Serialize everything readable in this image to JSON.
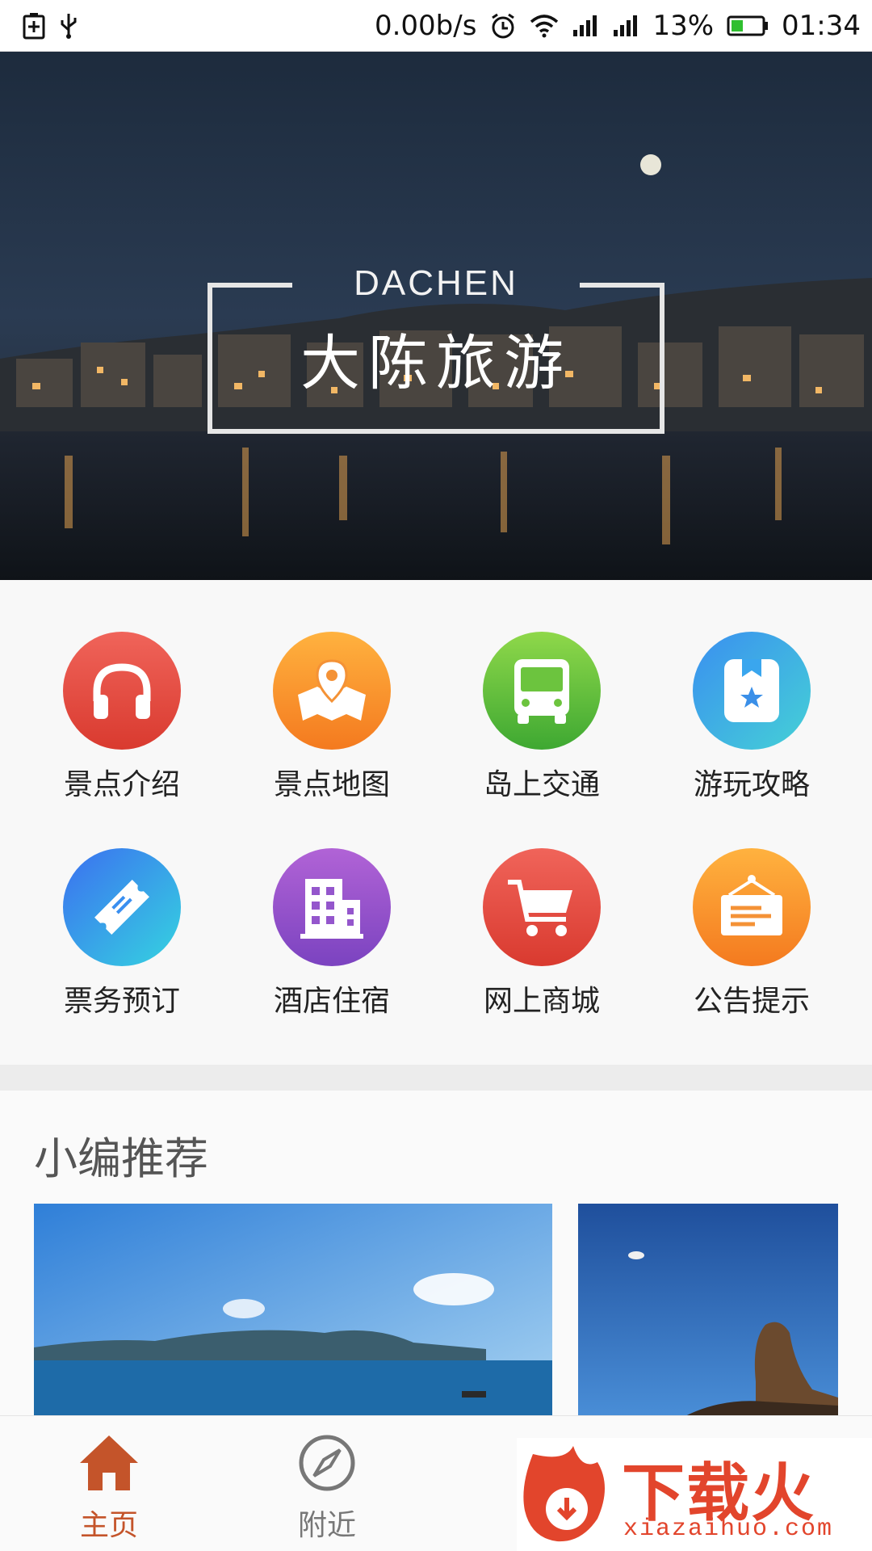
{
  "status_bar": {
    "network_speed": "0.00b/s",
    "battery": "13%",
    "time": "01:34"
  },
  "hero": {
    "title_en": "DACHEN",
    "title_cn": "大陈旅游"
  },
  "menu": {
    "items": [
      {
        "label": "景点介绍",
        "icon": "headphones-icon",
        "color_from": "#f0645a",
        "color_to": "#d93a2f"
      },
      {
        "label": "景点地图",
        "icon": "map-pin-icon",
        "color_from": "#ffb23f",
        "color_to": "#f47a1f"
      },
      {
        "label": "岛上交通",
        "icon": "bus-icon",
        "color_from": "#8fd84a",
        "color_to": "#3ea832"
      },
      {
        "label": "游玩攻略",
        "icon": "bookmark-star-icon",
        "color_from": "#3aa6ee",
        "color_to": "#45d1d6"
      },
      {
        "label": "票务预订",
        "icon": "ticket-icon",
        "color_from": "#3b7ff0",
        "color_to": "#35d4e0"
      },
      {
        "label": "酒店住宿",
        "icon": "hotel-icon",
        "color_from": "#b163d6",
        "color_to": "#7b43c0"
      },
      {
        "label": "网上商城",
        "icon": "cart-icon",
        "color_from": "#f0645a",
        "color_to": "#d93a2f"
      },
      {
        "label": "公告提示",
        "icon": "notice-board-icon",
        "color_from": "#ffb23f",
        "color_to": "#f47a1f"
      }
    ]
  },
  "recommend": {
    "title": "小编推荐"
  },
  "tabbar": {
    "home": "主页",
    "nearby": "附近",
    "active_color": "#c4542a"
  },
  "watermark": {
    "text": "下载火",
    "url": "xiazaihuo.com"
  }
}
